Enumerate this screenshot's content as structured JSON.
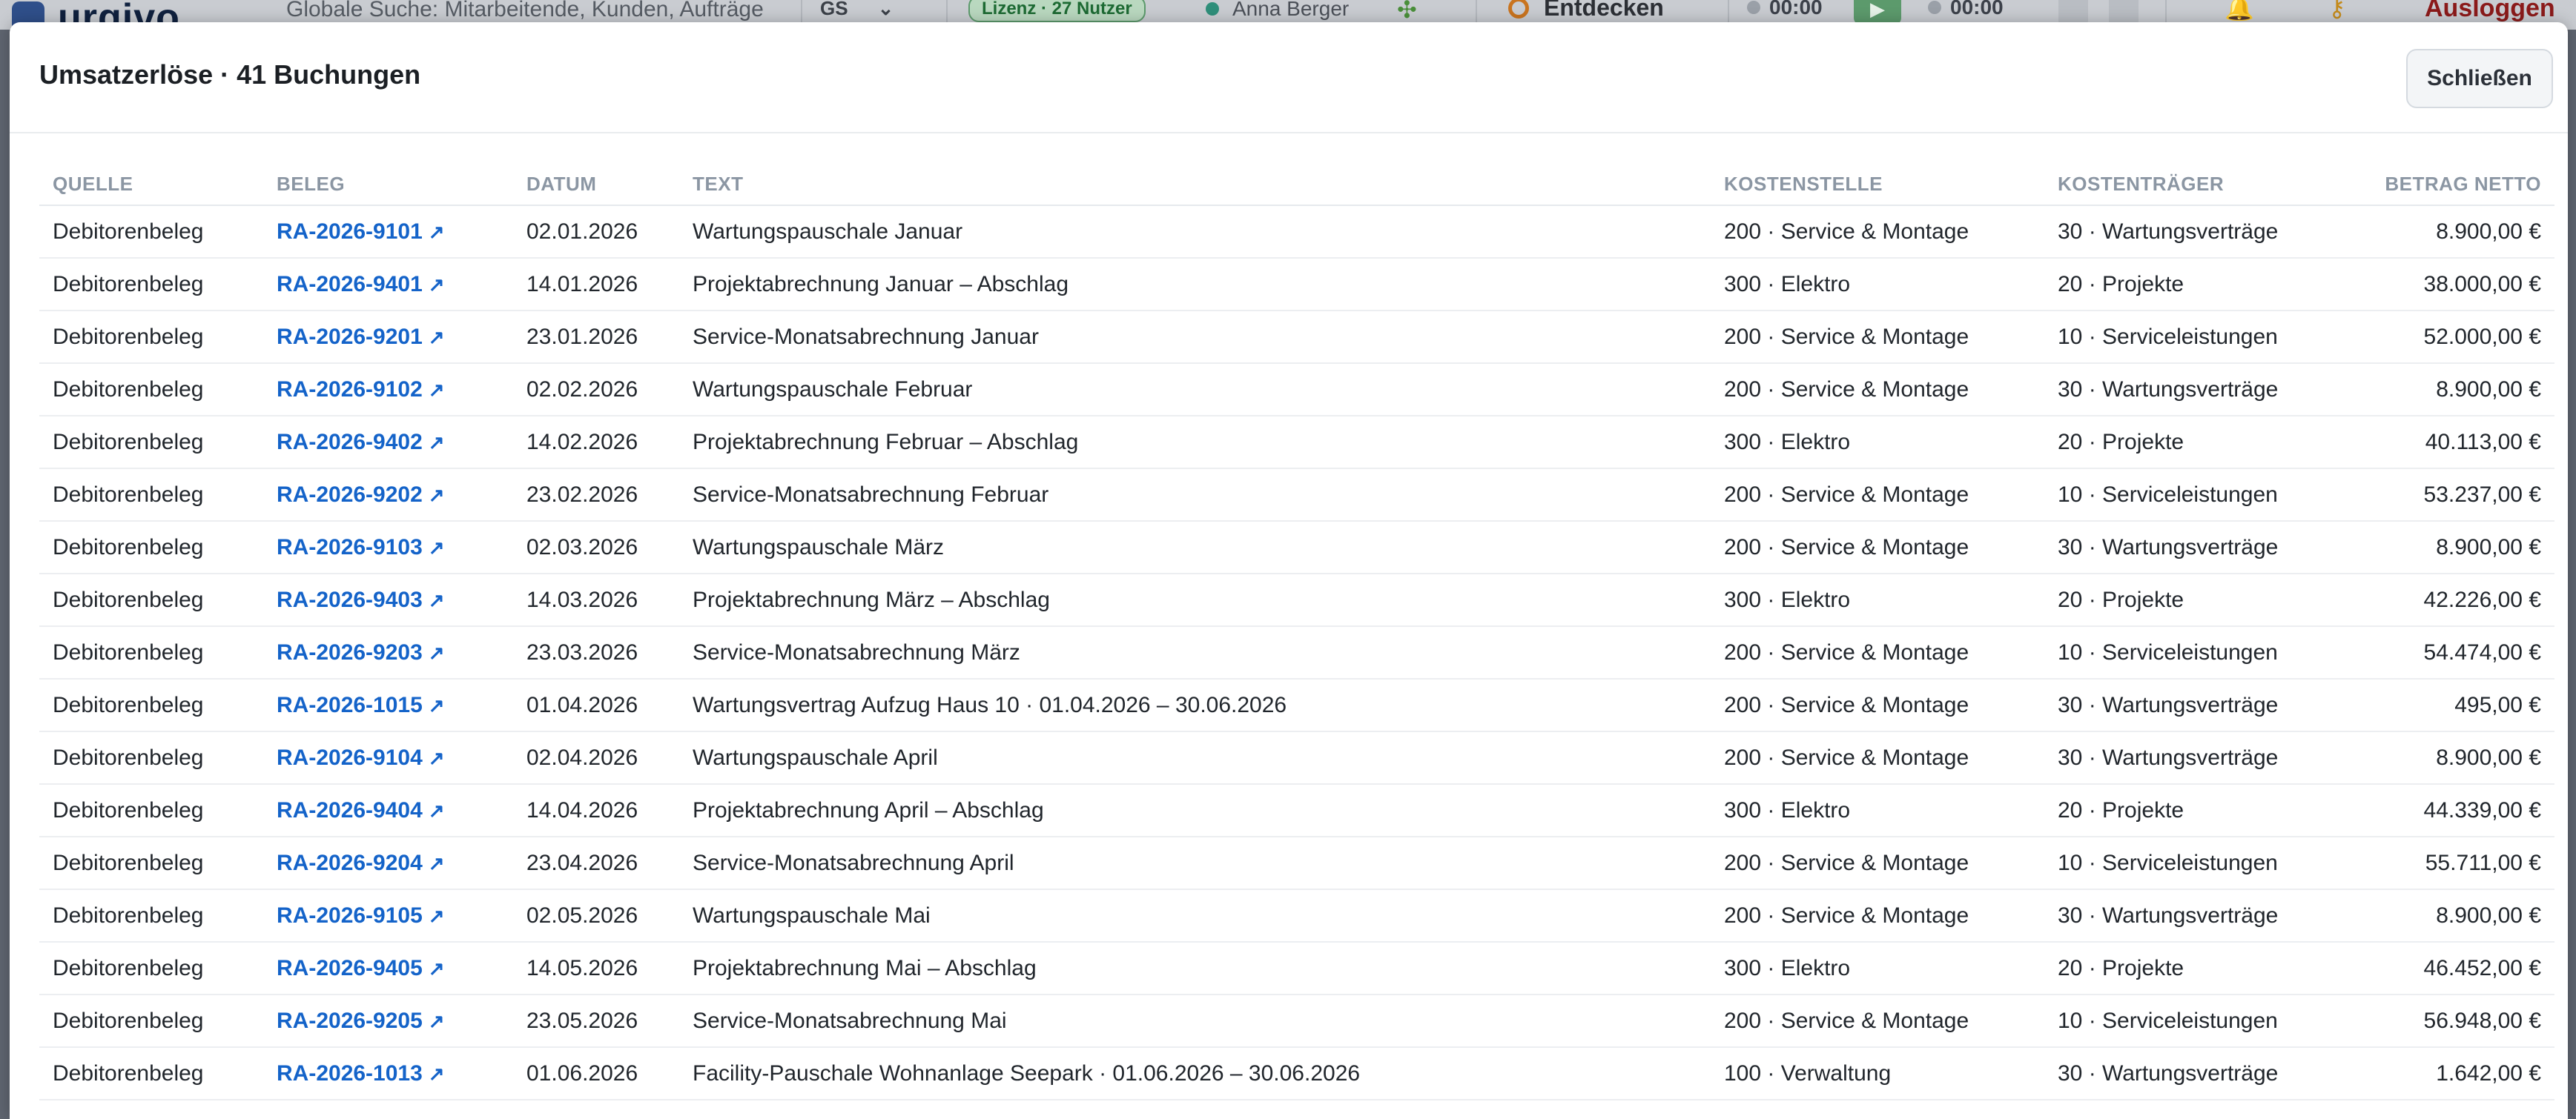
{
  "appbar": {
    "logo_text": "urgivo",
    "search_text": "Globale Suche: Mitarbeitende, Kunden, Aufträge",
    "company": "GS",
    "license": "Lizenz · 27 Nutzer",
    "user": "Anna Berger",
    "discover": "Entdecken",
    "timer1": "00:00",
    "timer2": "00:00",
    "logout": "Ausloggen"
  },
  "modal": {
    "title": "Umsatzerlöse · 41 Buchungen",
    "close_label": "Schließen"
  },
  "table": {
    "headers": {
      "quelle": "QUELLE",
      "beleg": "BELEG",
      "datum": "DATUM",
      "text": "TEXT",
      "kostenstelle": "KOSTENSTELLE",
      "kostentraeger": "KOSTENTRÄGER",
      "betrag": "BETRAG NETTO"
    },
    "link_icon": "↗",
    "rows": [
      {
        "quelle": "Debitorenbeleg",
        "beleg": "RA-2026-9101",
        "datum": "02.01.2026",
        "text": "Wartungspauschale Januar",
        "kostenstelle": "200 · Service & Montage",
        "kostentraeger": "30 · Wartungsverträge",
        "betrag": "8.900,00 €"
      },
      {
        "quelle": "Debitorenbeleg",
        "beleg": "RA-2026-9401",
        "datum": "14.01.2026",
        "text": "Projektabrechnung Januar – Abschlag",
        "kostenstelle": "300 · Elektro",
        "kostentraeger": "20 · Projekte",
        "betrag": "38.000,00 €"
      },
      {
        "quelle": "Debitorenbeleg",
        "beleg": "RA-2026-9201",
        "datum": "23.01.2026",
        "text": "Service-Monatsabrechnung Januar",
        "kostenstelle": "200 · Service & Montage",
        "kostentraeger": "10 · Serviceleistungen",
        "betrag": "52.000,00 €"
      },
      {
        "quelle": "Debitorenbeleg",
        "beleg": "RA-2026-9102",
        "datum": "02.02.2026",
        "text": "Wartungspauschale Februar",
        "kostenstelle": "200 · Service & Montage",
        "kostentraeger": "30 · Wartungsverträge",
        "betrag": "8.900,00 €"
      },
      {
        "quelle": "Debitorenbeleg",
        "beleg": "RA-2026-9402",
        "datum": "14.02.2026",
        "text": "Projektabrechnung Februar – Abschlag",
        "kostenstelle": "300 · Elektro",
        "kostentraeger": "20 · Projekte",
        "betrag": "40.113,00 €"
      },
      {
        "quelle": "Debitorenbeleg",
        "beleg": "RA-2026-9202",
        "datum": "23.02.2026",
        "text": "Service-Monatsabrechnung Februar",
        "kostenstelle": "200 · Service & Montage",
        "kostentraeger": "10 · Serviceleistungen",
        "betrag": "53.237,00 €"
      },
      {
        "quelle": "Debitorenbeleg",
        "beleg": "RA-2026-9103",
        "datum": "02.03.2026",
        "text": "Wartungspauschale März",
        "kostenstelle": "200 · Service & Montage",
        "kostentraeger": "30 · Wartungsverträge",
        "betrag": "8.900,00 €"
      },
      {
        "quelle": "Debitorenbeleg",
        "beleg": "RA-2026-9403",
        "datum": "14.03.2026",
        "text": "Projektabrechnung März – Abschlag",
        "kostenstelle": "300 · Elektro",
        "kostentraeger": "20 · Projekte",
        "betrag": "42.226,00 €"
      },
      {
        "quelle": "Debitorenbeleg",
        "beleg": "RA-2026-9203",
        "datum": "23.03.2026",
        "text": "Service-Monatsabrechnung März",
        "kostenstelle": "200 · Service & Montage",
        "kostentraeger": "10 · Serviceleistungen",
        "betrag": "54.474,00 €"
      },
      {
        "quelle": "Debitorenbeleg",
        "beleg": "RA-2026-1015",
        "datum": "01.04.2026",
        "text": "Wartungsvertrag Aufzug Haus 10 · 01.04.2026 – 30.06.2026",
        "kostenstelle": "200 · Service & Montage",
        "kostentraeger": "30 · Wartungsverträge",
        "betrag": "495,00 €"
      },
      {
        "quelle": "Debitorenbeleg",
        "beleg": "RA-2026-9104",
        "datum": "02.04.2026",
        "text": "Wartungspauschale April",
        "kostenstelle": "200 · Service & Montage",
        "kostentraeger": "30 · Wartungsverträge",
        "betrag": "8.900,00 €"
      },
      {
        "quelle": "Debitorenbeleg",
        "beleg": "RA-2026-9404",
        "datum": "14.04.2026",
        "text": "Projektabrechnung April – Abschlag",
        "kostenstelle": "300 · Elektro",
        "kostentraeger": "20 · Projekte",
        "betrag": "44.339,00 €"
      },
      {
        "quelle": "Debitorenbeleg",
        "beleg": "RA-2026-9204",
        "datum": "23.04.2026",
        "text": "Service-Monatsabrechnung April",
        "kostenstelle": "200 · Service & Montage",
        "kostentraeger": "10 · Serviceleistungen",
        "betrag": "55.711,00 €"
      },
      {
        "quelle": "Debitorenbeleg",
        "beleg": "RA-2026-9105",
        "datum": "02.05.2026",
        "text": "Wartungspauschale Mai",
        "kostenstelle": "200 · Service & Montage",
        "kostentraeger": "30 · Wartungsverträge",
        "betrag": "8.900,00 €"
      },
      {
        "quelle": "Debitorenbeleg",
        "beleg": "RA-2026-9405",
        "datum": "14.05.2026",
        "text": "Projektabrechnung Mai – Abschlag",
        "kostenstelle": "300 · Elektro",
        "kostentraeger": "20 · Projekte",
        "betrag": "46.452,00 €"
      },
      {
        "quelle": "Debitorenbeleg",
        "beleg": "RA-2026-9205",
        "datum": "23.05.2026",
        "text": "Service-Monatsabrechnung Mai",
        "kostenstelle": "200 · Service & Montage",
        "kostentraeger": "10 · Serviceleistungen",
        "betrag": "56.948,00 €"
      },
      {
        "quelle": "Debitorenbeleg",
        "beleg": "RA-2026-1013",
        "datum": "01.06.2026",
        "text": "Facility-Pauschale Wohnanlage Seepark · 01.06.2026 – 30.06.2026",
        "kostenstelle": "100 · Verwaltung",
        "kostentraeger": "30 · Wartungsverträge",
        "betrag": "1.642,00 €"
      }
    ]
  }
}
